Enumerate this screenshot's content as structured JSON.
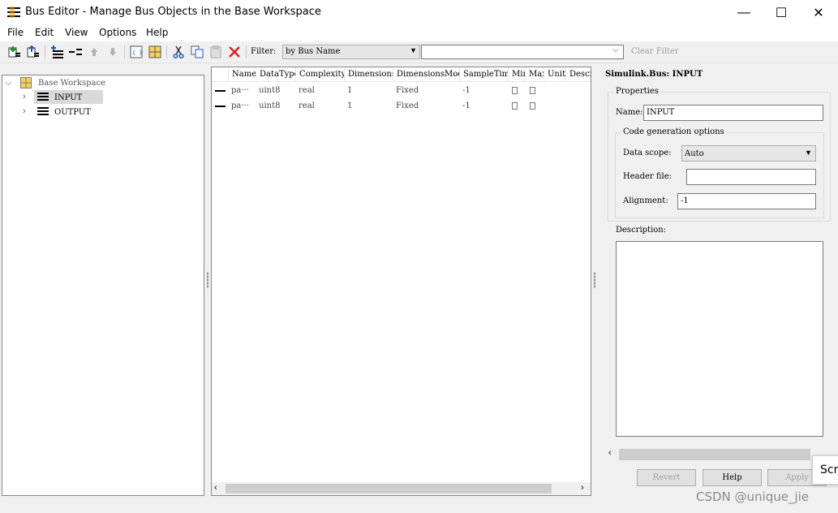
{
  "window": {
    "title": "Bus Editor - Manage Bus Objects in the Base Workspace",
    "minimize": "—",
    "maximize": "☐",
    "close": "✕"
  },
  "menu": [
    "File",
    "Edit",
    "View",
    "Options",
    "Help"
  ],
  "toolbar": {
    "filter_label": "Filter:",
    "filter_mode": "by Bus Name",
    "filter_value": "",
    "clear_filter": "Clear Filter"
  },
  "tree": {
    "root": "Base Workspace",
    "items": [
      "INPUT",
      "OUTPUT"
    ],
    "selected": "INPUT"
  },
  "table": {
    "columns": [
      "Name",
      "DataType",
      "Complexity",
      "Dimensions",
      "DimensionsMode",
      "SampleTime",
      "Min",
      "Max",
      "Unit",
      "Description"
    ],
    "rows": [
      {
        "name": "pa···",
        "datatype": "uint8",
        "complexity": "real",
        "dimensions": "1",
        "mode": "Fixed",
        "sampletime": "-1"
      },
      {
        "name": "pa···",
        "datatype": "uint8",
        "complexity": "real",
        "dimensions": "1",
        "mode": "Fixed",
        "sampletime": "-1"
      }
    ]
  },
  "props": {
    "title": "Simulink.Bus: INPUT",
    "properties_label": "Properties",
    "name_label": "Name:",
    "name_value": "INPUT",
    "codegen_label": "Code generation options",
    "scope_label": "Data scope:",
    "scope_value": "Auto",
    "header_label": "Header file:",
    "header_value": "",
    "alignment_label": "Alignment:",
    "alignment_value": "-1",
    "description_label": "Description:",
    "description_value": "",
    "buttons": {
      "revert": "Revert",
      "help": "Help",
      "apply": "Apply"
    }
  },
  "tooltip_text": "Scr",
  "watermark": "CSDN @unique_jie"
}
